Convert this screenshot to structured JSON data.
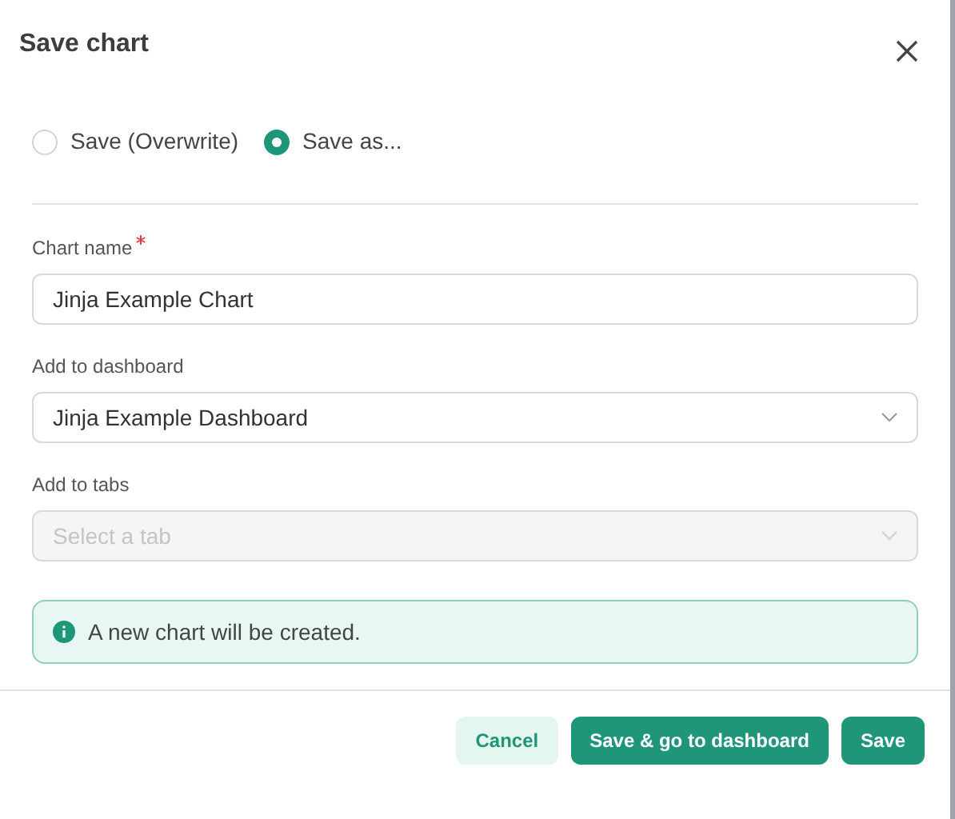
{
  "dialog": {
    "title": "Save chart"
  },
  "save_mode": [
    {
      "label": "Save (Overwrite)",
      "selected": false
    },
    {
      "label": "Save as...",
      "selected": true
    }
  ],
  "fields": [
    {
      "kind": "input",
      "label": "Chart name",
      "required": true,
      "disabled": false,
      "value": "Jinja Example Chart"
    },
    {
      "kind": "select",
      "label": "Add to dashboard",
      "required": false,
      "disabled": false,
      "value": "Jinja Example Dashboard"
    },
    {
      "kind": "select",
      "label": "Add to tabs",
      "required": false,
      "disabled": true,
      "placeholder": "Select a tab"
    }
  ],
  "alert": {
    "text": "A new chart will be created."
  },
  "buttons": [
    {
      "label": "Cancel",
      "kind": "secondary"
    },
    {
      "label": "Save & go to dashboard",
      "kind": "primary"
    },
    {
      "label": "Save",
      "kind": "primary"
    }
  ]
}
